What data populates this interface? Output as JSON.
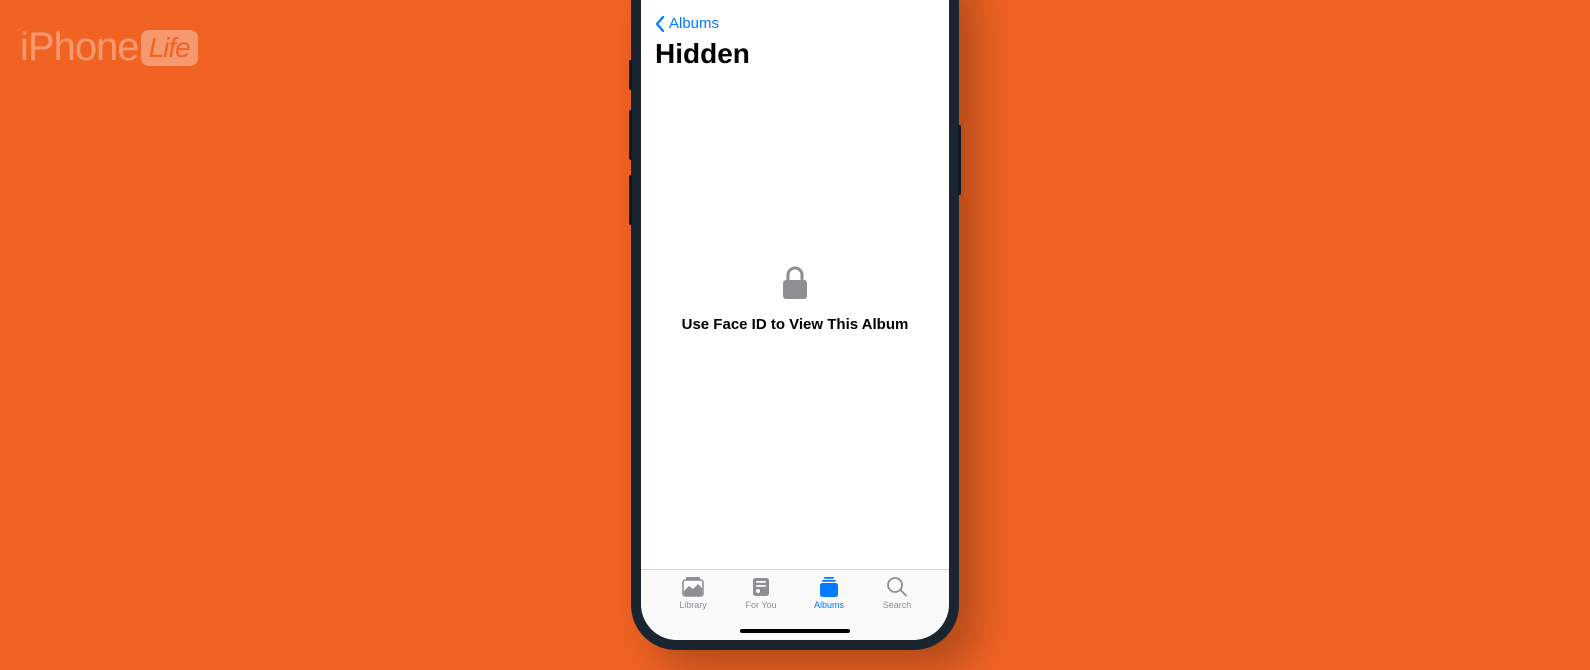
{
  "watermark": {
    "brand_prefix": "iPhone",
    "brand_suffix": "Life"
  },
  "nav": {
    "back_label": "Albums",
    "page_title": "Hidden"
  },
  "content": {
    "lock_message": "Use Face ID to View This Album"
  },
  "tabs": {
    "library": "Library",
    "for_you": "For You",
    "albums": "Albums",
    "search": "Search",
    "active": "albums"
  },
  "colors": {
    "background": "#f16323",
    "ios_blue": "#007aff",
    "ios_gray": "#8e8e93"
  }
}
